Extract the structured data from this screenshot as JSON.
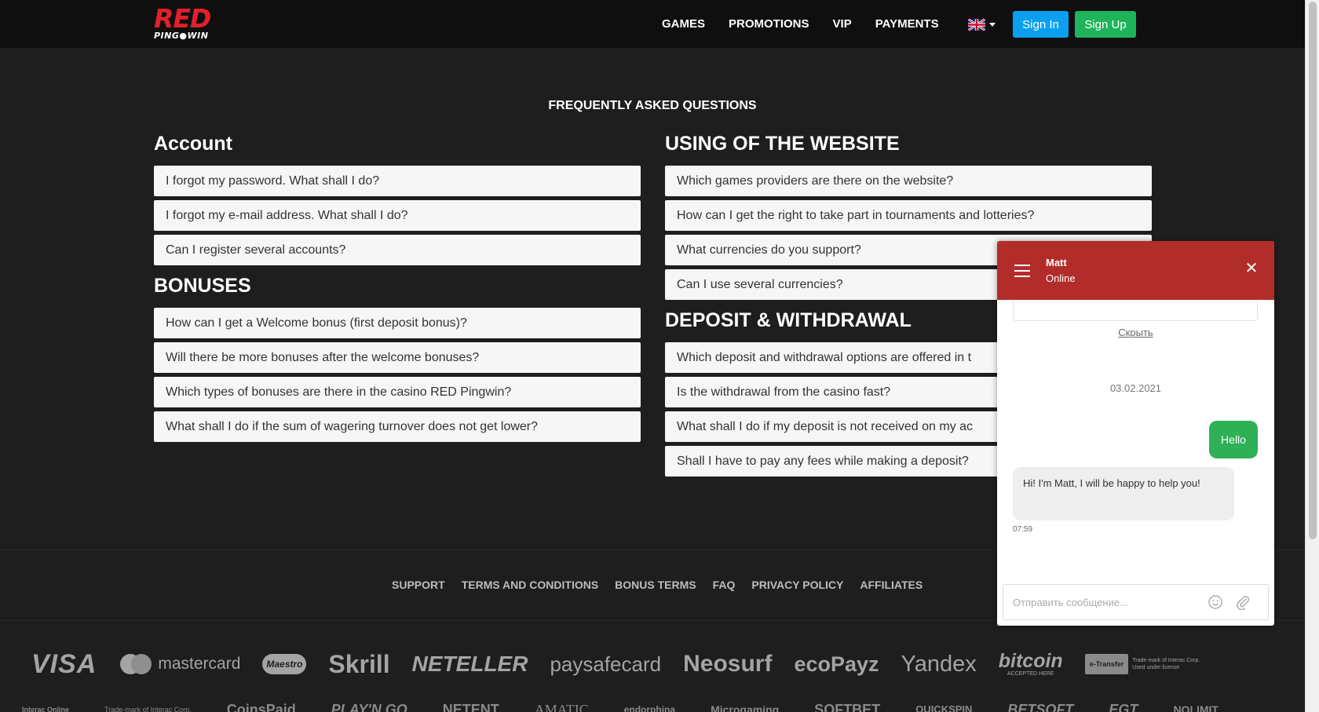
{
  "brand": {
    "logo_top": "RED",
    "logo_bottom": "PING●WIN",
    "accent": "#e2202b"
  },
  "nav": {
    "items": [
      "GAMES",
      "PROMOTIONS",
      "VIP",
      "PAYMENTS"
    ],
    "signin": "Sign In",
    "signup": "Sign Up",
    "language_icon": "uk-flag-icon"
  },
  "faq": {
    "title": "FREQUENTLY ASKED QUESTIONS",
    "sections": {
      "account": {
        "title": "Account",
        "questions": [
          "I forgot my password. What shall I do?",
          "I forgot my e-mail address. What shall I do?",
          "Can I register several accounts?"
        ]
      },
      "bonuses": {
        "title": "BONUSES",
        "questions": [
          "How can I get a Welcome bonus (first deposit bonus)?",
          "Will there be more bonuses after the welcome bonuses?",
          "Which types of bonuses are there in the casino RED Pingwin?",
          "What shall I do if the sum of wagering turnover does not get lower?"
        ]
      },
      "website": {
        "title": "USING OF THE WEBSITE",
        "questions": [
          "Which games providers are there on the website?",
          "How can I get the right to take part in tournaments and lotteries?",
          "What currencies do you support?",
          "Can I use several currencies?"
        ]
      },
      "deposit": {
        "title": "DEPOSIT & WITHDRAWAL",
        "questions": [
          "Which deposit and withdrawal options are offered in t",
          "Is the withdrawal from the casino fast?",
          "What shall I do if my deposit is not received on my ac",
          "Shall I have to pay any fees while making a deposit?"
        ]
      }
    }
  },
  "footer": {
    "links": [
      "SUPPORT",
      "TERMS AND CONDITIONS",
      "BONUS TERMS",
      "FAQ",
      "PRIVACY POLICY",
      "AFFILIATES"
    ]
  },
  "payment_logos": [
    "VISA",
    "mastercard",
    "Maestro",
    "Skrill",
    "NETELLER",
    "paysafecard",
    "Neosurf",
    "ecoPayz",
    "Yandex",
    "bitcoin",
    "ACCEPTED HERE",
    "e-Transfer",
    "Trade-mark of Interac Corp. Used under license"
  ],
  "provider_logos": [
    "Interac Online",
    "Trade-mark of Interac Corp.",
    "CoinsPaid",
    "PLAY'N GO",
    "NETENT",
    "AMATIC",
    "endorphina",
    "Microgaming",
    "SOFTBET",
    "QUICKSPIN",
    "BETSOFT",
    "EGT",
    "NOLIMIT"
  ],
  "chat": {
    "agent": "Matt",
    "status": "Online",
    "hide": "Скрыть",
    "date": "03.02.2021",
    "outgoing": "Hello",
    "incoming": "Hi! I'm Matt, I will be happy to help you!",
    "time": "07:59",
    "placeholder": "Отправить сообщение...",
    "header_color": "#b22d2a",
    "bubble_color": "#2eb056"
  }
}
